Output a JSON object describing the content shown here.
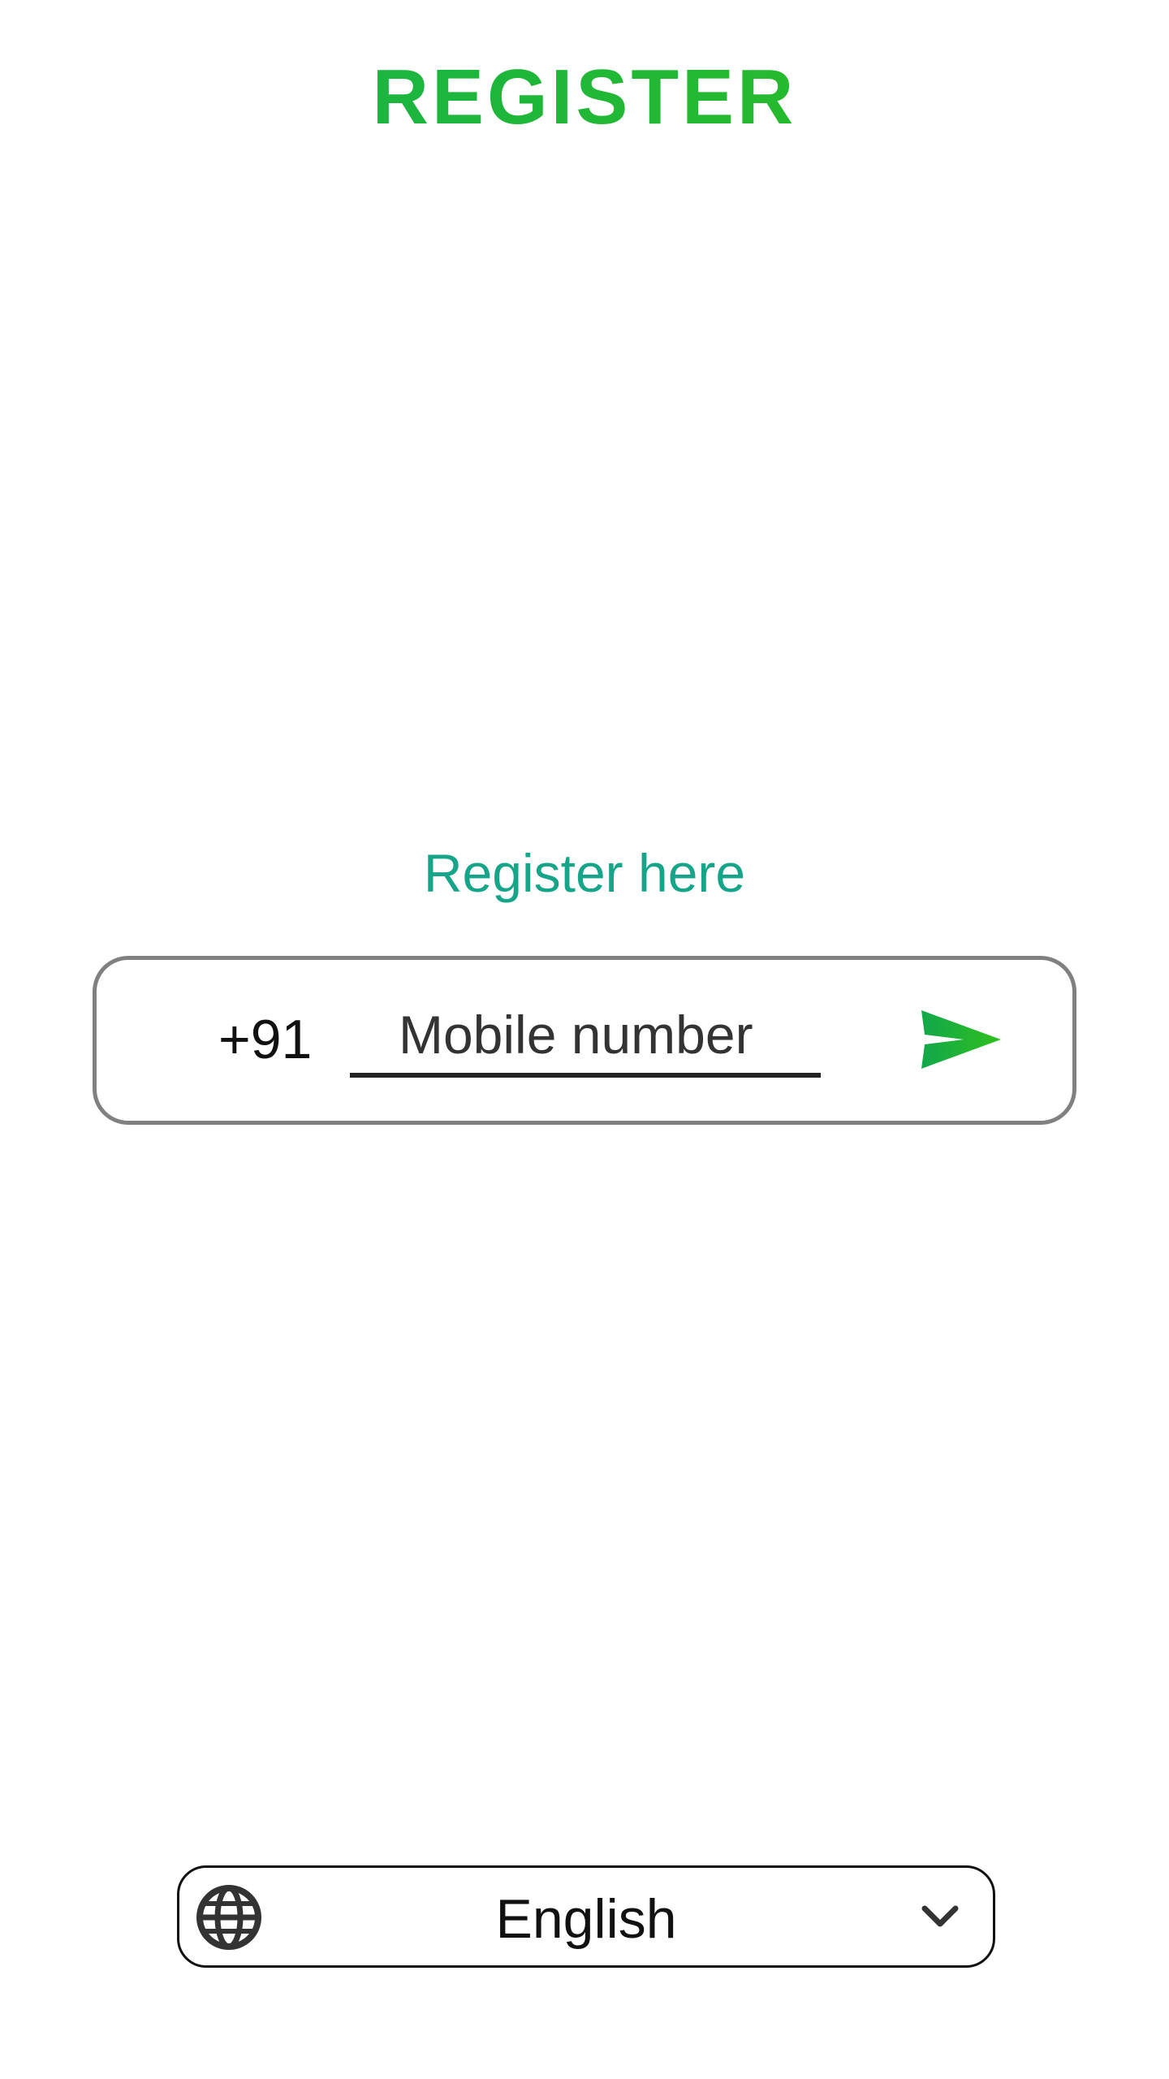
{
  "header": {
    "title": "REGISTER"
  },
  "form": {
    "subtitle": "Register here",
    "country_code": "+91",
    "mobile_placeholder": "Mobile number",
    "mobile_value": "",
    "send_icon": "send-icon"
  },
  "language": {
    "icon": "globe-icon",
    "selected": "English",
    "dropdown_icon": "chevron-down-icon"
  },
  "colors": {
    "title_gradient_start": "#12b04f",
    "title_gradient_end": "#2fbf1e",
    "subtitle": "#17a589",
    "card_border": "#808080",
    "send_icon": "#1db954"
  }
}
